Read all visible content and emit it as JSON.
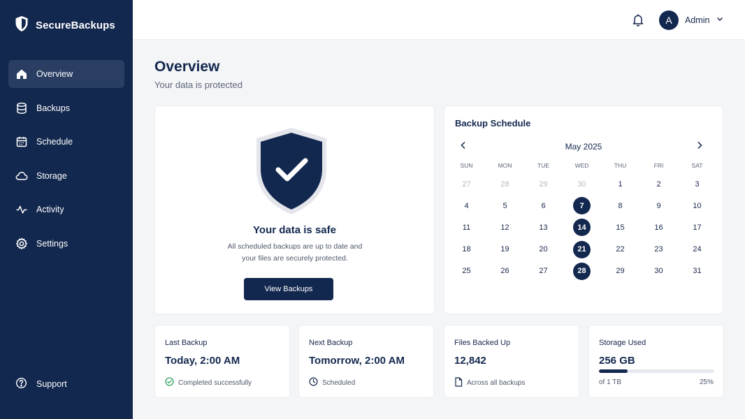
{
  "brand": {
    "name": "SecureBackups"
  },
  "sidebar": {
    "items": [
      {
        "label": "Overview",
        "icon": "home-icon",
        "active": true
      },
      {
        "label": "Backups",
        "icon": "database-icon"
      },
      {
        "label": "Schedule",
        "icon": "calendar-icon"
      },
      {
        "label": "Storage",
        "icon": "cloud-icon"
      },
      {
        "label": "Activity",
        "icon": "activity-icon"
      },
      {
        "label": "Settings",
        "icon": "gear-icon"
      }
    ],
    "support_label": "Support"
  },
  "topbar": {
    "avatar_initial": "A",
    "user_name": "Admin"
  },
  "main": {
    "title": "Overview",
    "subtitle": "Your data is protected"
  },
  "status_card": {
    "title": "Your data is safe",
    "description_line1": "All scheduled backups are up to date and",
    "description_line2": "your files are securely protected.",
    "button_label": "View Backups"
  },
  "schedule": {
    "title": "Backup Schedule",
    "month_label": "May 2025",
    "weekdays": [
      "SUN",
      "MON",
      "TUE",
      "WED",
      "THU",
      "FRI",
      "SAT"
    ],
    "weeks": [
      [
        {
          "d": "27",
          "muted": true
        },
        {
          "d": "28",
          "muted": true
        },
        {
          "d": "29",
          "muted": true
        },
        {
          "d": "30",
          "muted": true
        },
        {
          "d": "1"
        },
        {
          "d": "2"
        },
        {
          "d": "3"
        }
      ],
      [
        {
          "d": "4"
        },
        {
          "d": "5"
        },
        {
          "d": "6"
        },
        {
          "d": "7",
          "marked": true
        },
        {
          "d": "8"
        },
        {
          "d": "9"
        },
        {
          "d": "10"
        }
      ],
      [
        {
          "d": "11"
        },
        {
          "d": "12"
        },
        {
          "d": "13"
        },
        {
          "d": "14",
          "marked": true
        },
        {
          "d": "15"
        },
        {
          "d": "16"
        },
        {
          "d": "17"
        }
      ],
      [
        {
          "d": "18"
        },
        {
          "d": "19"
        },
        {
          "d": "20"
        },
        {
          "d": "21",
          "marked": true
        },
        {
          "d": "22"
        },
        {
          "d": "23"
        },
        {
          "d": "24"
        }
      ],
      [
        {
          "d": "25"
        },
        {
          "d": "26"
        },
        {
          "d": "27"
        },
        {
          "d": "28",
          "marked": true
        },
        {
          "d": "29"
        },
        {
          "d": "30"
        },
        {
          "d": "31"
        }
      ]
    ]
  },
  "stats": {
    "last_backup": {
      "label": "Last Backup",
      "value": "Today, 2:00 AM",
      "meta": "Completed successfully"
    },
    "next_backup": {
      "label": "Next Backup",
      "value": "Tomorrow, 2:00 AM",
      "meta": "Scheduled"
    },
    "files": {
      "label": "Files Backed Up",
      "value": "12,842",
      "meta": "Across all backups"
    },
    "storage": {
      "label": "Storage Used",
      "value": "256 GB",
      "of_label": "of 1 TB",
      "percent_label": "25%",
      "percent": 25
    }
  },
  "colors": {
    "navy": "#13284f",
    "success": "#2e9e5b"
  }
}
